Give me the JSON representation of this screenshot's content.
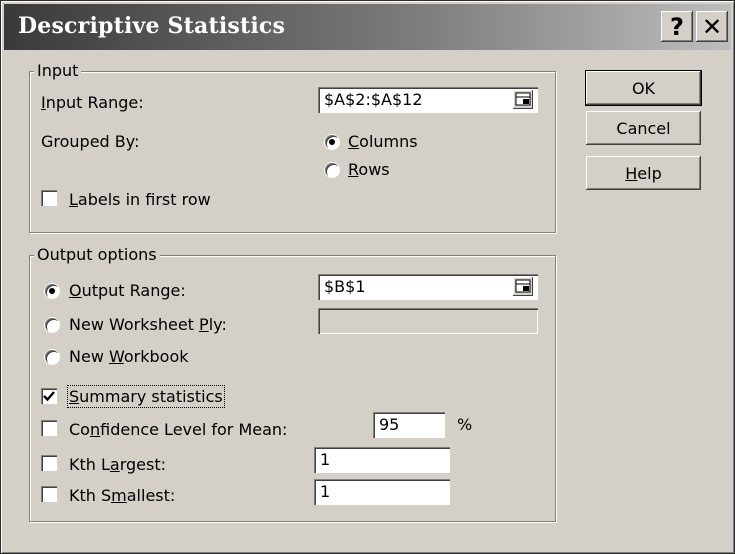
{
  "window": {
    "title": "Descriptive Statistics"
  },
  "titlebar_buttons": {
    "help": "?",
    "close": "✕"
  },
  "input_group": {
    "legend": "Input",
    "input_range_label": "Input Range:",
    "input_range_value": "$A$2:$A$12",
    "grouped_by_label": "Grouped By:",
    "columns_label": "Columns",
    "rows_label": "Rows",
    "grouped_by_selected": "Columns",
    "labels_first_row_label": "Labels in first row",
    "labels_first_row_checked": false
  },
  "output_group": {
    "legend": "Output options",
    "output_range_label": "Output Range:",
    "output_range_value": "$B$1",
    "new_worksheet_label": "New Worksheet Ply:",
    "new_worksheet_value": "",
    "new_workbook_label": "New Workbook",
    "output_selected": "Output Range",
    "summary_label": "Summary statistics",
    "summary_checked": true,
    "confidence_label": "Confidence Level for Mean:",
    "confidence_value": "95",
    "confidence_unit": "%",
    "confidence_checked": false,
    "kth_largest_label": "Kth Largest:",
    "kth_largest_value": "1",
    "kth_largest_checked": false,
    "kth_smallest_label": "Kth Smallest:",
    "kth_smallest_value": "1",
    "kth_smallest_checked": false
  },
  "buttons": {
    "ok": "OK",
    "cancel": "Cancel",
    "help": "Help"
  }
}
